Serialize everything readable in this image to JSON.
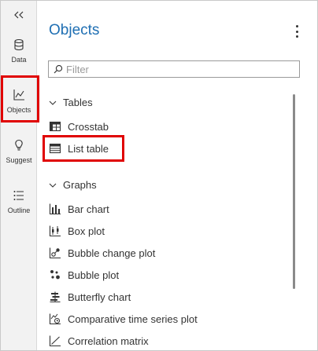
{
  "rail": {
    "items": [
      {
        "id": "data",
        "label": "Data",
        "icon": "database-icon"
      },
      {
        "id": "objects",
        "label": "Objects",
        "icon": "line-chart-icon"
      },
      {
        "id": "suggest",
        "label": "Suggest",
        "icon": "lightbulb-icon"
      },
      {
        "id": "outline",
        "label": "Outline",
        "icon": "list-icon"
      }
    ],
    "collapse_icon": "double-chevron-left-icon"
  },
  "panel": {
    "title": "Objects",
    "menu_icon": "kebab-menu-icon",
    "filter": {
      "placeholder": "Filter",
      "value": ""
    }
  },
  "groups": [
    {
      "label": "Tables",
      "items": [
        {
          "label": "Crosstab",
          "icon": "crosstab-icon"
        },
        {
          "label": "List table",
          "icon": "list-table-icon"
        }
      ]
    },
    {
      "label": "Graphs",
      "items": [
        {
          "label": "Bar chart",
          "icon": "bar-chart-icon"
        },
        {
          "label": "Box plot",
          "icon": "box-plot-icon"
        },
        {
          "label": "Bubble change plot",
          "icon": "bubble-change-plot-icon"
        },
        {
          "label": "Bubble plot",
          "icon": "bubble-plot-icon"
        },
        {
          "label": "Butterfly chart",
          "icon": "butterfly-chart-icon"
        },
        {
          "label": "Comparative time series plot",
          "icon": "comparative-time-series-icon"
        },
        {
          "label": "Correlation matrix",
          "icon": "correlation-matrix-icon"
        }
      ]
    }
  ],
  "colors": {
    "accent": "#1f6fb3",
    "highlight": "#e00000",
    "rail_bg": "#f2f2f2"
  }
}
